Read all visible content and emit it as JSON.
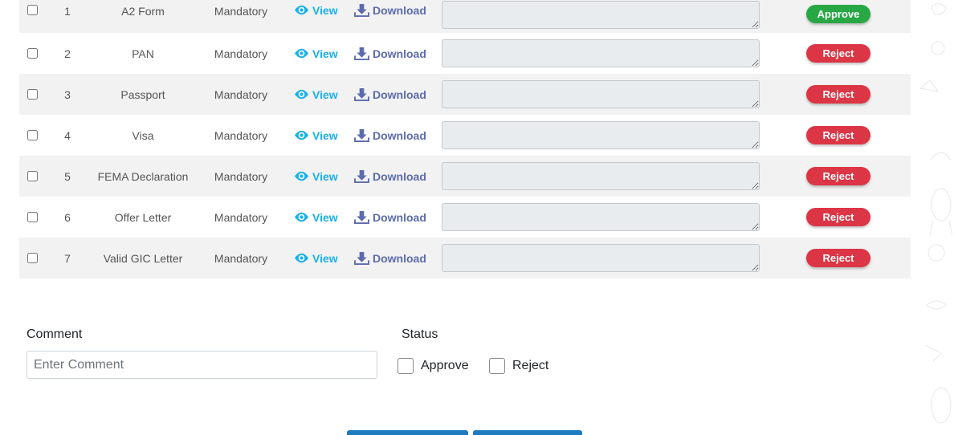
{
  "documents": [
    {
      "num": "1",
      "name": "A2 Form",
      "requirement": "Mandatory",
      "view_label": "View",
      "download_label": "Download",
      "remark": "",
      "status_label": "Approve",
      "status": "approve"
    },
    {
      "num": "2",
      "name": "PAN",
      "requirement": "Mandatory",
      "view_label": "View",
      "download_label": "Download",
      "remark": "",
      "status_label": "Reject",
      "status": "reject"
    },
    {
      "num": "3",
      "name": "Passport",
      "requirement": "Mandatory",
      "view_label": "View",
      "download_label": "Download",
      "remark": "",
      "status_label": "Reject",
      "status": "reject"
    },
    {
      "num": "4",
      "name": "Visa",
      "requirement": "Mandatory",
      "view_label": "View",
      "download_label": "Download",
      "remark": "",
      "status_label": "Reject",
      "status": "reject"
    },
    {
      "num": "5",
      "name": "FEMA Declaration",
      "requirement": "Mandatory",
      "view_label": "View",
      "download_label": "Download",
      "remark": "",
      "status_label": "Reject",
      "status": "reject"
    },
    {
      "num": "6",
      "name": "Offer Letter",
      "requirement": "Mandatory",
      "view_label": "View",
      "download_label": "Download",
      "remark": "",
      "status_label": "Reject",
      "status": "reject"
    },
    {
      "num": "7",
      "name": "Valid GIC Letter",
      "requirement": "Mandatory",
      "view_label": "View",
      "download_label": "Download",
      "remark": "",
      "status_label": "Reject",
      "status": "reject"
    }
  ],
  "form": {
    "comment_label": "Comment",
    "comment_placeholder": "Enter Comment",
    "comment_value": "",
    "status_label": "Status",
    "approve_label": "Approve",
    "reject_label": "Reject"
  },
  "colors": {
    "approve": "#28a745",
    "reject": "#dc3545",
    "view_link": "#1ab0e8",
    "download_link": "#5c6bab",
    "primary_button": "#1f7bc0"
  },
  "icons": {
    "view": "eye-icon",
    "download": "download-icon"
  }
}
